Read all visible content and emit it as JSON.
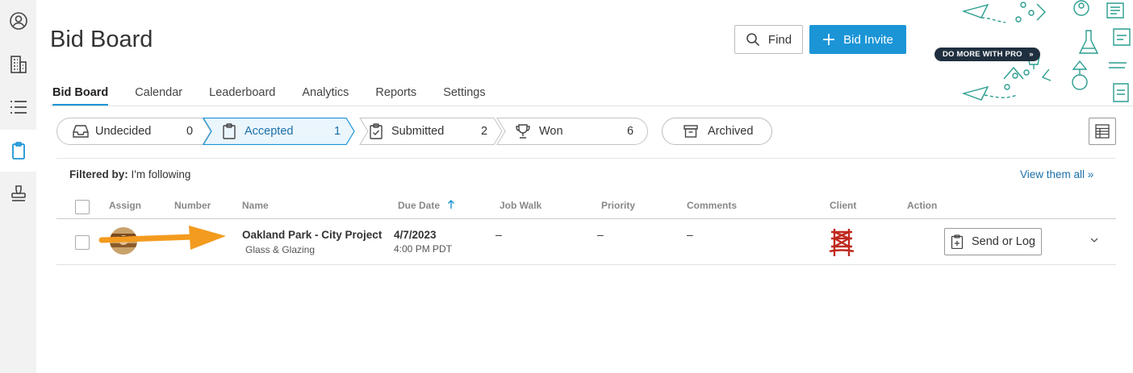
{
  "sidebar": {
    "items": [
      {
        "name": "account-icon"
      },
      {
        "name": "building-icon"
      },
      {
        "name": "list-icon"
      },
      {
        "name": "clipboard-icon",
        "active": true
      },
      {
        "name": "stamp-icon"
      }
    ]
  },
  "header": {
    "title": "Bid Board",
    "find_label": "Find",
    "invite_label": "Bid Invite",
    "promo_badge": "DO MORE WITH PRO"
  },
  "tabs": [
    {
      "label": "Bid Board",
      "active": true
    },
    {
      "label": "Calendar"
    },
    {
      "label": "Leaderboard"
    },
    {
      "label": "Analytics"
    },
    {
      "label": "Reports"
    },
    {
      "label": "Settings"
    }
  ],
  "stages": [
    {
      "label": "Undecided",
      "count": "0",
      "icon": "inbox-icon"
    },
    {
      "label": "Accepted",
      "count": "1",
      "icon": "clipboard-icon",
      "selected": true
    },
    {
      "label": "Submitted",
      "count": "2",
      "icon": "clipboard-check-icon"
    },
    {
      "label": "Won",
      "count": "6",
      "icon": "trophy-icon"
    }
  ],
  "archived_label": "Archived",
  "filter": {
    "prefix": "Filtered by:",
    "value": "I'm following",
    "view_all": "View them all »"
  },
  "columns": {
    "assign": "Assign",
    "number": "Number",
    "name": "Name",
    "due_date": "Due Date",
    "job_walk": "Job Walk",
    "priority": "Priority",
    "comments": "Comments",
    "client": "Client",
    "action": "Action"
  },
  "rows": [
    {
      "name": "Oakland Park - City Project",
      "trade": "Glass & Glazing",
      "due_date": "4/7/2023",
      "due_time": "4:00 PM PDT",
      "job_walk": "–",
      "priority": "–",
      "comments": "–",
      "action_label": "Send or Log"
    }
  ],
  "colors": {
    "accent": "#1b95d6",
    "link": "#1b6fa8",
    "arrow": "#f39b1f",
    "client_logo": "#c0281e"
  }
}
